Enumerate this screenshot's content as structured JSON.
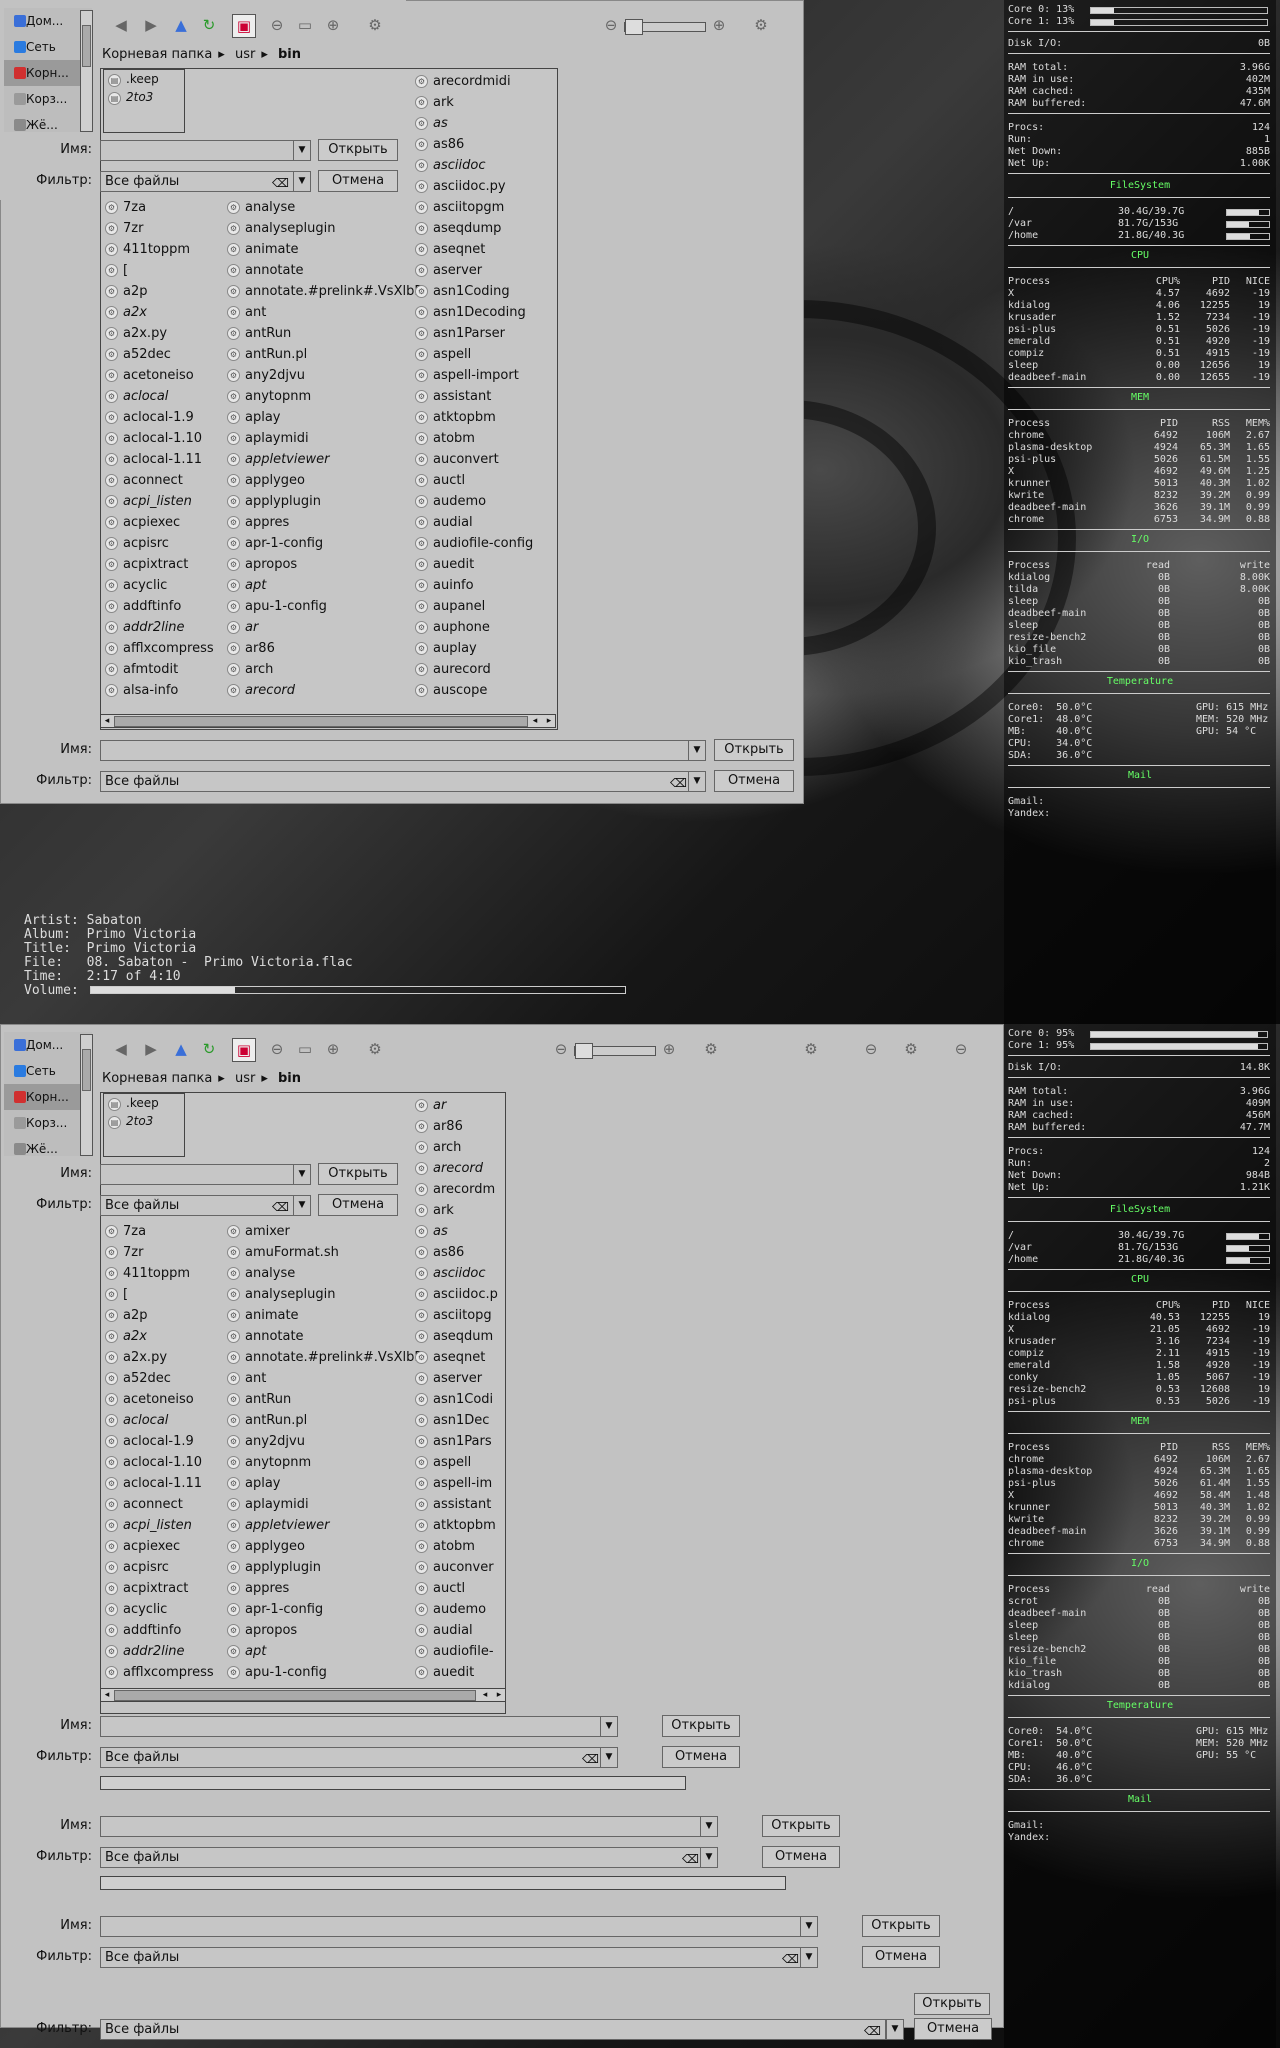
{
  "dialog": {
    "places": [
      "Дом...",
      "Сеть",
      "Корн...",
      "Корз...",
      "Жё..."
    ],
    "breadcrumb": [
      "Корневая папка",
      "usr",
      "bin"
    ],
    "name_label": "Имя:",
    "filter_label": "Фильтр:",
    "filter_value": "Все файлы",
    "open_button": "Открыть",
    "cancel_button": "Отмена",
    "mini_files": [
      ".keep",
      "2to3"
    ]
  },
  "screen1": {
    "files": [
      [
        "7za",
        "7zr",
        "411toppm",
        "[",
        "a2p",
        "a2x",
        "a2x.py",
        "a52dec",
        "acetoneiso",
        "aclocal",
        "aclocal-1.9",
        "aclocal-1.10",
        "aclocal-1.11",
        "aconnect",
        "acpi_listen",
        "acpiexec",
        "acpisrc",
        "acpixtract",
        "acyclic",
        "addftinfo",
        "addr2line",
        "afflxcompress",
        "afmtodit",
        "alsa-info"
      ],
      [
        "analyse",
        "analyseplugin",
        "animate",
        "annotate",
        "annotate.#prelink#.VsXlbB",
        "ant",
        "antRun",
        "antRun.pl",
        "any2djvu",
        "anytopnm",
        "aplay",
        "aplaymidi",
        "appletviewer",
        "applygeo",
        "applyplugin",
        "appres",
        "apr-1-config",
        "apropos",
        "apt",
        "apu-1-config",
        "ar",
        "ar86",
        "arch",
        "arecord"
      ],
      [
        "arecordmidi",
        "ark",
        "as",
        "as86",
        "asciidoc",
        "asciidoc.py",
        "asciitopgm",
        "aseqdump",
        "aseqnet",
        "aserver",
        "asn1Coding",
        "asn1Decoding",
        "asn1Parser",
        "aspell",
        "aspell-import",
        "assistant",
        "atktopbm",
        "atobm",
        "auconvert",
        "auctl",
        "audemo",
        "audial",
        "audiofile-config",
        "auedit",
        "auinfo",
        "aupanel",
        "auphone",
        "auplay",
        "aurecord",
        "auscope"
      ]
    ],
    "terminal": {
      "lines": [
        "Artist: Sabaton",
        "Album:  Primo Victoria",
        "Title:  Primo Victoria",
        "File:   08. Sabaton -  Primo Victoria.flac",
        "Time:   2:17 of 4:10",
        "Volume:"
      ],
      "volume_fraction": 0.27
    },
    "conky": {
      "cpu": [
        "Core 0: 13%",
        "Core 1: 13%"
      ],
      "cpu_fraction": [
        0.13,
        0.13
      ],
      "disk_io": [
        "Disk I/O:",
        "0B"
      ],
      "ram": [
        [
          "RAM total:",
          "3.96G"
        ],
        [
          "RAM in use:",
          "402M"
        ],
        [
          "RAM cached:",
          "435M"
        ],
        [
          "RAM buffered:",
          "47.6M"
        ]
      ],
      "procs": [
        [
          "Procs:",
          "124"
        ],
        [
          "Run:",
          "1"
        ],
        [
          "Net Down:",
          "885B"
        ],
        [
          "Net Up:",
          "1.00K"
        ]
      ],
      "fs": [
        [
          "/",
          "30.4G/39.7G",
          0.77
        ],
        [
          "/var",
          "81.7G/153G",
          0.53
        ],
        [
          "/home",
          "21.8G/40.3G",
          0.54
        ]
      ],
      "cpu_head": [
        "Process",
        "CPU%",
        "PID",
        "NICE"
      ],
      "cpu_rows": [
        [
          "X",
          "4.57",
          "4692",
          "-19"
        ],
        [
          "kdialog",
          "4.06",
          "12255",
          "19"
        ],
        [
          "krusader",
          "1.52",
          "7234",
          "-19"
        ],
        [
          "psi-plus",
          "0.51",
          "5026",
          "-19"
        ],
        [
          "emerald",
          "0.51",
          "4920",
          "-19"
        ],
        [
          "compiz",
          "0.51",
          "4915",
          "-19"
        ],
        [
          "sleep",
          "0.00",
          "12656",
          "19"
        ],
        [
          "deadbeef-main",
          "0.00",
          "12655",
          "-19"
        ]
      ],
      "mem_head": [
        "Process",
        "PID",
        "RSS",
        "MEM%"
      ],
      "mem_rows": [
        [
          "chrome",
          "6492",
          "106M",
          "2.67"
        ],
        [
          "plasma-desktop",
          "4924",
          "65.3M",
          "1.65"
        ],
        [
          "psi-plus",
          "5026",
          "61.5M",
          "1.55"
        ],
        [
          "X",
          "4692",
          "49.6M",
          "1.25"
        ],
        [
          "krunner",
          "5013",
          "40.3M",
          "1.02"
        ],
        [
          "kwrite",
          "8232",
          "39.2M",
          "0.99"
        ],
        [
          "deadbeef-main",
          "3626",
          "39.1M",
          "0.99"
        ],
        [
          "chrome",
          "6753",
          "34.9M",
          "0.88"
        ]
      ],
      "io_head": [
        "Process",
        "read",
        "write"
      ],
      "io_rows": [
        [
          "kdialog",
          "0B",
          "8.00K"
        ],
        [
          "tilda",
          "0B",
          "8.00K"
        ],
        [
          "sleep",
          "0B",
          "0B"
        ],
        [
          "deadbeef-main",
          "0B",
          "0B"
        ],
        [
          "sleep",
          "0B",
          "0B"
        ],
        [
          "resize-bench2",
          "0B",
          "0B"
        ],
        [
          "kio_file",
          "0B",
          "0B"
        ],
        [
          "kio_trash",
          "0B",
          "0B"
        ]
      ],
      "temp": [
        [
          "Core0:  50.0°C",
          "GPU: 615 MHz"
        ],
        [
          "Core1:  48.0°C",
          "MEM: 520 MHz"
        ],
        [
          "MB:     40.0°C",
          "GPU: 54 °C"
        ],
        [
          "CPU:    34.0°C",
          ""
        ],
        [
          "SDA:    36.0°C",
          ""
        ]
      ],
      "mail": [
        "Gmail:",
        "Yandex:"
      ]
    }
  },
  "screen2": {
    "files": [
      [
        "7za",
        "7zr",
        "411toppm",
        "[",
        "a2p",
        "a2x",
        "a2x.py",
        "a52dec",
        "acetoneiso",
        "aclocal",
        "aclocal-1.9",
        "aclocal-1.10",
        "aclocal-1.11",
        "aconnect",
        "acpi_listen",
        "acpiexec",
        "acpisrc",
        "acpixtract",
        "acyclic",
        "addftinfo",
        "addr2line",
        "afflxcompress"
      ],
      [
        "amixer",
        "amuFormat.sh",
        "analyse",
        "analyseplugin",
        "animate",
        "annotate",
        "annotate.#prelink#.VsXlbB",
        "ant",
        "antRun",
        "antRun.pl",
        "any2djvu",
        "anytopnm",
        "aplay",
        "aplaymidi",
        "appletviewer",
        "applygeo",
        "applyplugin",
        "appres",
        "apr-1-config",
        "apropos",
        "apt",
        "apu-1-config"
      ],
      [
        "ar",
        "ar86",
        "arch",
        "arecord",
        "arecordm",
        "ark",
        "as",
        "as86",
        "asciidoc",
        "asciidoc.p",
        "asciitopg",
        "aseqdum",
        "aseqnet",
        "aserver",
        "asn1Codi",
        "asn1Dec",
        "asn1Pars",
        "aspell",
        "aspell-im",
        "assistant",
        "atktopbm",
        "atobm",
        "auconver",
        "auctl",
        "audemo",
        "audial",
        "audiofile-",
        "auedit"
      ]
    ],
    "conky": {
      "cpu": [
        "Core 0: 95%",
        "Core 1: 95%"
      ],
      "cpu_fraction": [
        0.95,
        0.95
      ],
      "disk_io": [
        "Disk I/O:",
        "14.8K"
      ],
      "ram": [
        [
          "RAM total:",
          "3.96G"
        ],
        [
          "RAM in use:",
          "409M"
        ],
        [
          "RAM cached:",
          "456M"
        ],
        [
          "RAM buffered:",
          "47.7M"
        ]
      ],
      "procs": [
        [
          "Procs:",
          "124"
        ],
        [
          "Run:",
          "2"
        ],
        [
          "Net Down:",
          "984B"
        ],
        [
          "Net Up:",
          "1.21K"
        ]
      ],
      "fs": [
        [
          "/",
          "30.4G/39.7G",
          0.77
        ],
        [
          "/var",
          "81.7G/153G",
          0.53
        ],
        [
          "/home",
          "21.8G/40.3G",
          0.54
        ]
      ],
      "cpu_head": [
        "Process",
        "CPU%",
        "PID",
        "NICE"
      ],
      "cpu_rows": [
        [
          "kdialog",
          "40.53",
          "12255",
          "19"
        ],
        [
          "X",
          "21.05",
          "4692",
          "-19"
        ],
        [
          "krusader",
          "3.16",
          "7234",
          "-19"
        ],
        [
          "compiz",
          "2.11",
          "4915",
          "-19"
        ],
        [
          "emerald",
          "1.58",
          "4920",
          "-19"
        ],
        [
          "conky",
          "1.05",
          "5067",
          "-19"
        ],
        [
          "resize-bench2",
          "0.53",
          "12608",
          "19"
        ],
        [
          "psi-plus",
          "0.53",
          "5026",
          "-19"
        ]
      ],
      "mem_head": [
        "Process",
        "PID",
        "RSS",
        "MEM%"
      ],
      "mem_rows": [
        [
          "chrome",
          "6492",
          "106M",
          "2.67"
        ],
        [
          "plasma-desktop",
          "4924",
          "65.3M",
          "1.65"
        ],
        [
          "psi-plus",
          "5026",
          "61.4M",
          "1.55"
        ],
        [
          "X",
          "4692",
          "58.4M",
          "1.48"
        ],
        [
          "krunner",
          "5013",
          "40.3M",
          "1.02"
        ],
        [
          "kwrite",
          "8232",
          "39.2M",
          "0.99"
        ],
        [
          "deadbeef-main",
          "3626",
          "39.1M",
          "0.99"
        ],
        [
          "chrome",
          "6753",
          "34.9M",
          "0.88"
        ]
      ],
      "io_head": [
        "Process",
        "read",
        "write"
      ],
      "io_rows": [
        [
          "scrot",
          "0B",
          "0B"
        ],
        [
          "deadbeef-main",
          "0B",
          "0B"
        ],
        [
          "sleep",
          "0B",
          "0B"
        ],
        [
          "sleep",
          "0B",
          "0B"
        ],
        [
          "resize-bench2",
          "0B",
          "0B"
        ],
        [
          "kio_file",
          "0B",
          "0B"
        ],
        [
          "kio_trash",
          "0B",
          "0B"
        ],
        [
          "kdialog",
          "0B",
          "0B"
        ]
      ],
      "temp": [
        [
          "Core0:  54.0°C",
          "GPU: 615 MHz"
        ],
        [
          "Core1:  50.0°C",
          "MEM: 520 MHz"
        ],
        [
          "MB:     40.0°C",
          "GPU: 55 °C"
        ],
        [
          "CPU:    46.0°C",
          ""
        ],
        [
          "SDA:    36.0°C",
          ""
        ]
      ],
      "mail": [
        "Gmail:",
        "Yandex:"
      ]
    }
  },
  "conky_headings": {
    "filesystem": "FileSystem",
    "cpu": "CPU",
    "mem": "MEM",
    "io": "I/O",
    "temperature": "Temperature",
    "mail": "Mail"
  }
}
